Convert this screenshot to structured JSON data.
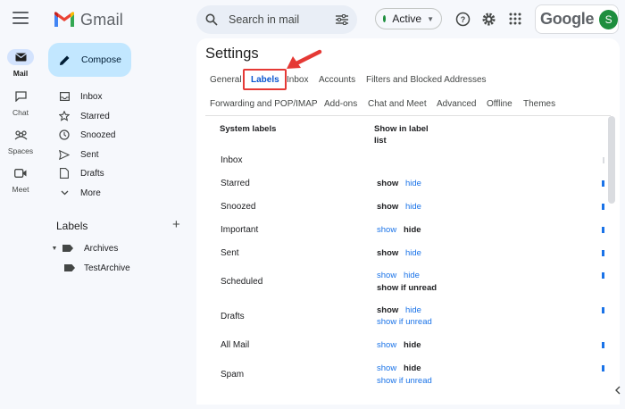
{
  "app": {
    "name": "Gmail"
  },
  "search": {
    "placeholder": "Search in mail"
  },
  "status": {
    "label": "Active",
    "color": "#1e8e3e"
  },
  "account": {
    "brand": "Google",
    "avatar_letter": "S"
  },
  "rail": [
    {
      "label": "Mail",
      "icon": "mail-icon",
      "active": true
    },
    {
      "label": "Chat",
      "icon": "chat-icon",
      "active": false
    },
    {
      "label": "Spaces",
      "icon": "spaces-icon",
      "active": false
    },
    {
      "label": "Meet",
      "icon": "meet-icon",
      "active": false
    }
  ],
  "compose": {
    "label": "Compose"
  },
  "folders": [
    {
      "label": "Inbox",
      "icon": "inbox-icon"
    },
    {
      "label": "Starred",
      "icon": "star-icon"
    },
    {
      "label": "Snoozed",
      "icon": "clock-icon"
    },
    {
      "label": "Sent",
      "icon": "send-icon"
    },
    {
      "label": "Drafts",
      "icon": "draft-icon"
    },
    {
      "label": "More",
      "icon": "chevron-down-icon"
    }
  ],
  "labels_section": {
    "title": "Labels",
    "items": [
      {
        "label": "Archives",
        "icon": "label-icon"
      },
      {
        "label": "TestArchive",
        "icon": "label-icon"
      }
    ]
  },
  "settings": {
    "title": "Settings",
    "tabs_row1": [
      "General",
      "Labels",
      "Inbox",
      "Accounts",
      "Filters and Blocked Addresses"
    ],
    "tabs_row2": [
      "Forwarding and POP/IMAP",
      "Add-ons",
      "Chat and Meet",
      "Advanced",
      "Offline",
      "Themes"
    ],
    "active_tab": "Labels",
    "highlight_color": "#e53935",
    "col_system": "System labels",
    "col_show_line1": "Show in label",
    "col_show_line2": "list",
    "rows": [
      {
        "label": "Inbox",
        "show": "",
        "hide": "",
        "unread": ""
      },
      {
        "label": "Starred",
        "show": "show",
        "hide": "hide",
        "unread": ""
      },
      {
        "label": "Snoozed",
        "show": "show",
        "hide": "hide",
        "unread": ""
      },
      {
        "label": "Important",
        "show": "show",
        "hide": "hide",
        "unread": ""
      },
      {
        "label": "Sent",
        "show": "show",
        "hide": "hide",
        "unread": ""
      },
      {
        "label": "Scheduled",
        "show": "show",
        "hide": "hide",
        "unread": "show if unread"
      },
      {
        "label": "Drafts",
        "show": "show",
        "hide": "hide",
        "unread": "show if unread"
      },
      {
        "label": "All Mail",
        "show": "show",
        "hide": "hide",
        "unread": ""
      },
      {
        "label": "Spam",
        "show": "show",
        "hide": "hide",
        "unread": "show if unread"
      }
    ]
  }
}
